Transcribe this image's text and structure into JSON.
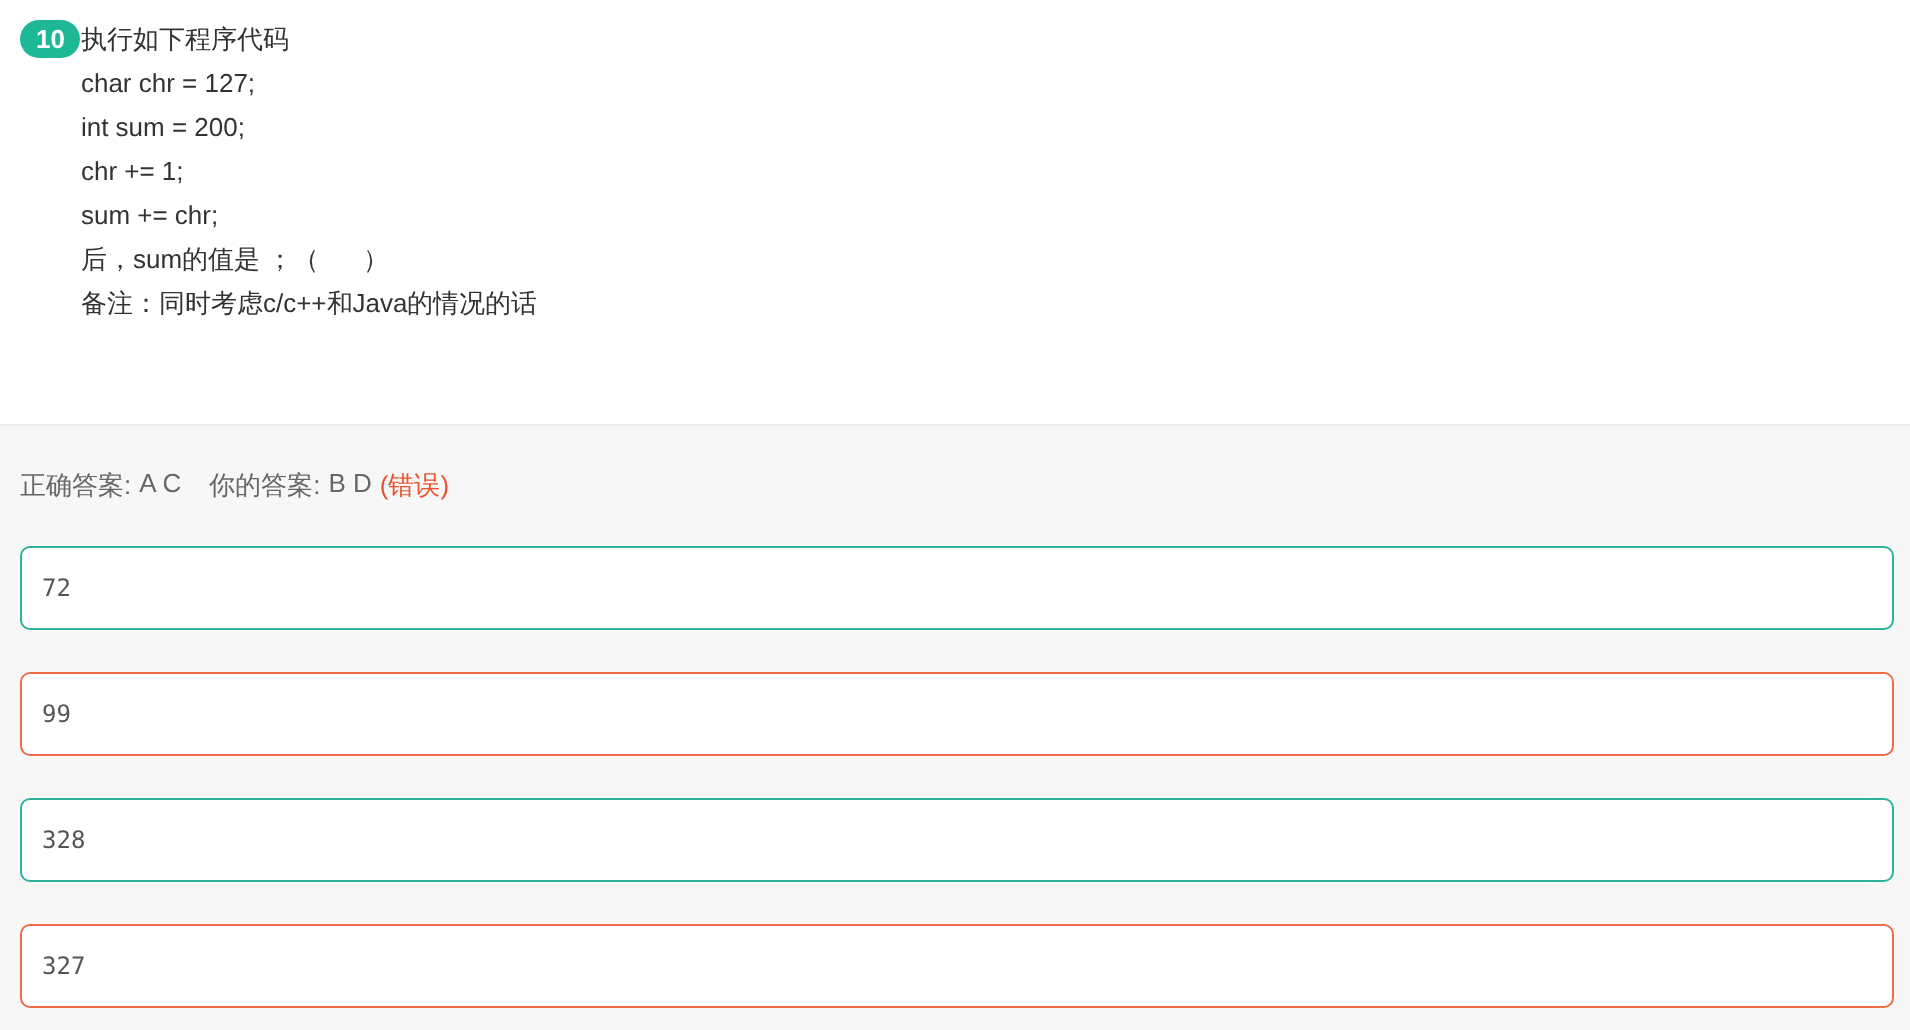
{
  "question": {
    "number": "10",
    "lines": [
      "执行如下程序代码",
      "char chr = 127;",
      "int sum = 200;",
      "chr += 1;",
      "sum += chr;",
      "后，sum的值是 ；（      ）",
      "备注：同时考虑c/c++和Java的情况的话"
    ]
  },
  "result": {
    "correct_label": "正确答案:",
    "correct_value": "A C",
    "yours_label": "你的答案:",
    "yours_value": "B D",
    "verdict": "(错误)"
  },
  "options": [
    {
      "text": "72",
      "correct": true
    },
    {
      "text": "99",
      "correct": false
    },
    {
      "text": "328",
      "correct": true
    },
    {
      "text": "327",
      "correct": false
    }
  ]
}
